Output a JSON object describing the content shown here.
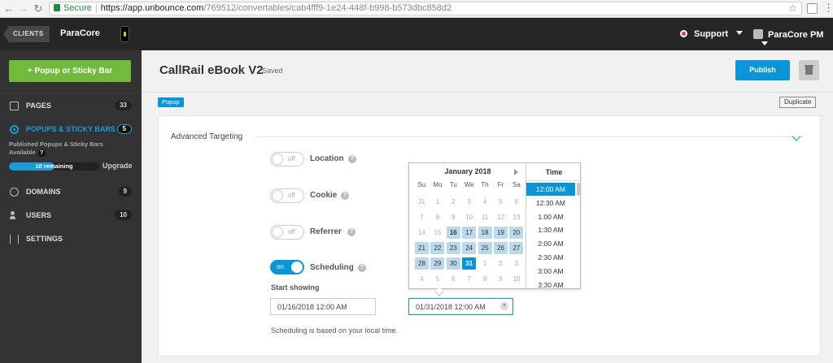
{
  "browser": {
    "secure_label": "Secure",
    "url_scheme_host": "https://app.unbounce.com",
    "url_path": "/769512/convertables/cab4fff9-1e24-448f-b998-b573dbc858d2"
  },
  "topbar": {
    "clients_label": "CLIENTS",
    "brand": "ParaCore",
    "support_label": "Support",
    "account_label": "ParaCore PM"
  },
  "sidebar": {
    "add_button": "+ Popup or Sticky Bar",
    "items": [
      {
        "label": "PAGES",
        "count": "33"
      },
      {
        "label": "POPUPS & STICKY BARS",
        "count": "5"
      },
      {
        "label": "DOMAINS",
        "count": "9"
      },
      {
        "label": "USERS",
        "count": "10"
      },
      {
        "label": "SETTINGS",
        "count": ""
      }
    ],
    "published_note": "Published Popups & Sticky Bars Available",
    "help_glyph": "?",
    "remaining_label": "10 remaining",
    "remaining_fraction": 0.5,
    "upgrade_label": "Upgrade"
  },
  "page": {
    "title": "CallRail eBook V2",
    "status": "Saved",
    "publish_label": "Publish",
    "badge": "Popup",
    "duplicate_label": "Duplicate"
  },
  "targeting": {
    "section_title": "Advanced Targeting",
    "rows": [
      {
        "label": "Location",
        "toggle": "off"
      },
      {
        "label": "Cookie",
        "toggle": "off"
      },
      {
        "label": "Referrer",
        "toggle": "off"
      },
      {
        "label": "Scheduling",
        "toggle": "on"
      }
    ],
    "help_glyph": "?",
    "start_label": "Start showing",
    "start_value": "01/16/2018 12:00 AM",
    "end_value": "01/31/2018 12:00 AM",
    "note": "Scheduling is based on your local time."
  },
  "datepicker": {
    "month": "January 2018",
    "weekdays": [
      "Su",
      "Mo",
      "Tu",
      "We",
      "Th",
      "Fr",
      "Sa"
    ],
    "weeks": [
      [
        "31",
        "1",
        "2",
        "3",
        "4",
        "5",
        "6"
      ],
      [
        "7",
        "8",
        "9",
        "10",
        "11",
        "12",
        "13"
      ],
      [
        "14",
        "15",
        "16",
        "17",
        "18",
        "19",
        "20"
      ],
      [
        "21",
        "22",
        "23",
        "24",
        "25",
        "26",
        "27"
      ],
      [
        "28",
        "29",
        "30",
        "31",
        "1",
        "2",
        "3"
      ],
      [
        "4",
        "5",
        "6",
        "7",
        "8",
        "9",
        "10"
      ]
    ],
    "time_label": "Time",
    "times": [
      "12:00 AM",
      "12:30 AM",
      "1:00 AM",
      "1:30 AM",
      "2:00 AM",
      "2:30 AM",
      "3:00 AM",
      "3:30 AM"
    ]
  },
  "colors": {
    "accent": "#0a95d9",
    "add_button": "#71ba3c",
    "topbar": "#262626",
    "sidebar": "#333333",
    "range_fill": "#bcd9ea"
  },
  "icons": {
    "back": "arrow-left-icon",
    "forward": "arrow-right-icon",
    "reload": "reload-icon",
    "lock": "lock-icon",
    "bookmark": "star-icon",
    "pages": "pages-icon",
    "popups": "target-icon",
    "domains": "globe-icon",
    "users": "users-icon",
    "settings": "sliders-icon",
    "delete": "trash-icon",
    "collapse": "chevron-down-icon"
  }
}
